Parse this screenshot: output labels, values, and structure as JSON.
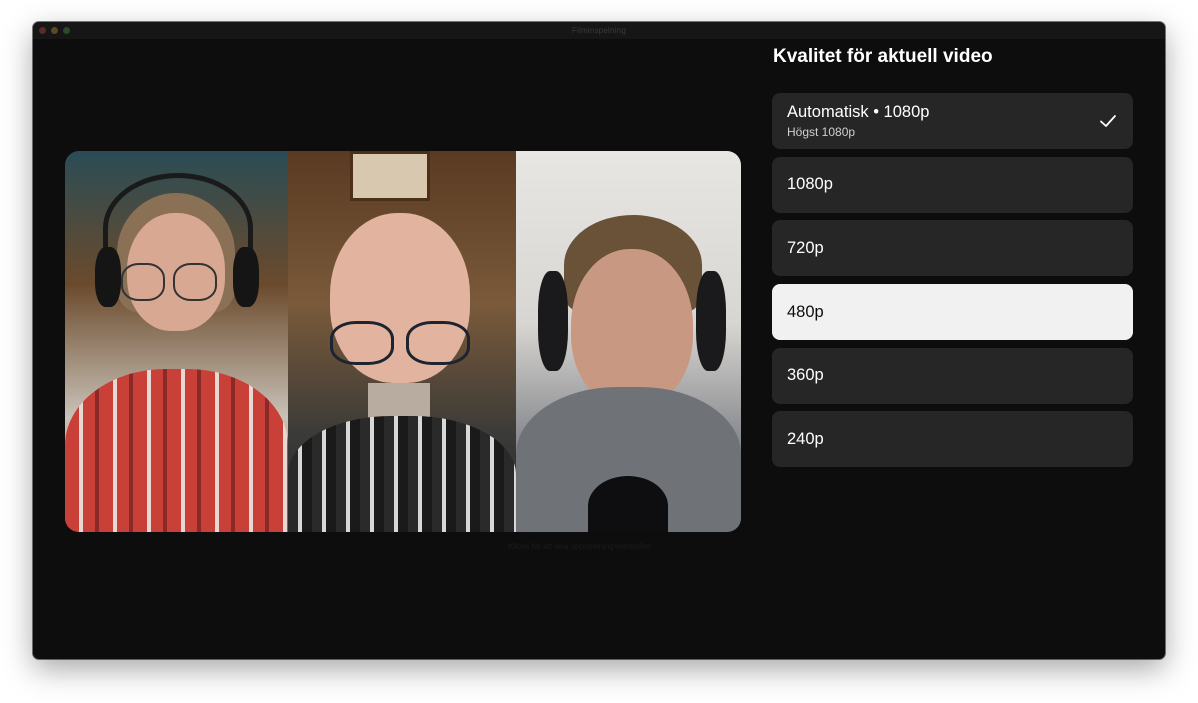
{
  "window": {
    "title": "Filminspelning"
  },
  "panel": {
    "title": "Kvalitet för aktuell video",
    "options": [
      {
        "label": "Automatisk • 1080p",
        "sublabel": "Högst 1080p",
        "checked": true,
        "highlighted": false
      },
      {
        "label": "1080p",
        "checked": false,
        "highlighted": false
      },
      {
        "label": "720p",
        "checked": false,
        "highlighted": false
      },
      {
        "label": "480p",
        "checked": false,
        "highlighted": true
      },
      {
        "label": "360p",
        "checked": false,
        "highlighted": false
      },
      {
        "label": "240p",
        "checked": false,
        "highlighted": false
      }
    ],
    "colors": {
      "option_bg": "#262626",
      "highlight_bg": "#f1f1f1",
      "window_bg": "#0d0d0d"
    }
  },
  "video": {
    "caption": "Klicka för att visa uppspelningskontroller"
  },
  "icons": {
    "checked": "checkmark-icon"
  }
}
